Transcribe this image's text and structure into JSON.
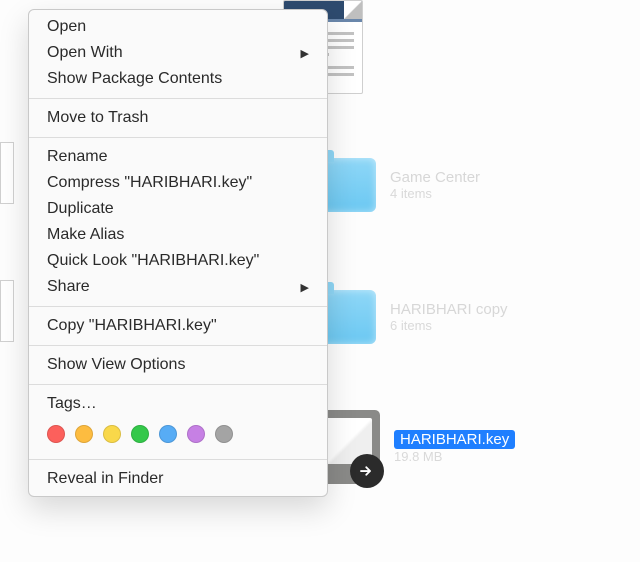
{
  "menu": {
    "open": "Open",
    "open_with": "Open With",
    "show_pkg": "Show Package Contents",
    "trash": "Move to Trash",
    "rename": "Rename",
    "compress": "Compress \"HARIBHARI.key\"",
    "duplicate": "Duplicate",
    "alias": "Make Alias",
    "quicklook": "Quick Look \"HARIBHARI.key\"",
    "share": "Share",
    "copy": "Copy \"HARIBHARI.key\"",
    "viewopts": "Show View Options",
    "tags": "Tags…",
    "reveal": "Reveal in Finder"
  },
  "items": {
    "game_center": {
      "name": "Game Center",
      "sub": "4 items"
    },
    "hari_copy": {
      "name": "HARIBHARI copy",
      "sub": "6 items"
    },
    "hari_key": {
      "name": "HARIBHARI.key",
      "sub": "19.8 MB"
    }
  },
  "tag_colors": [
    "red",
    "orange",
    "yellow",
    "green",
    "blue",
    "purple",
    "gray"
  ]
}
